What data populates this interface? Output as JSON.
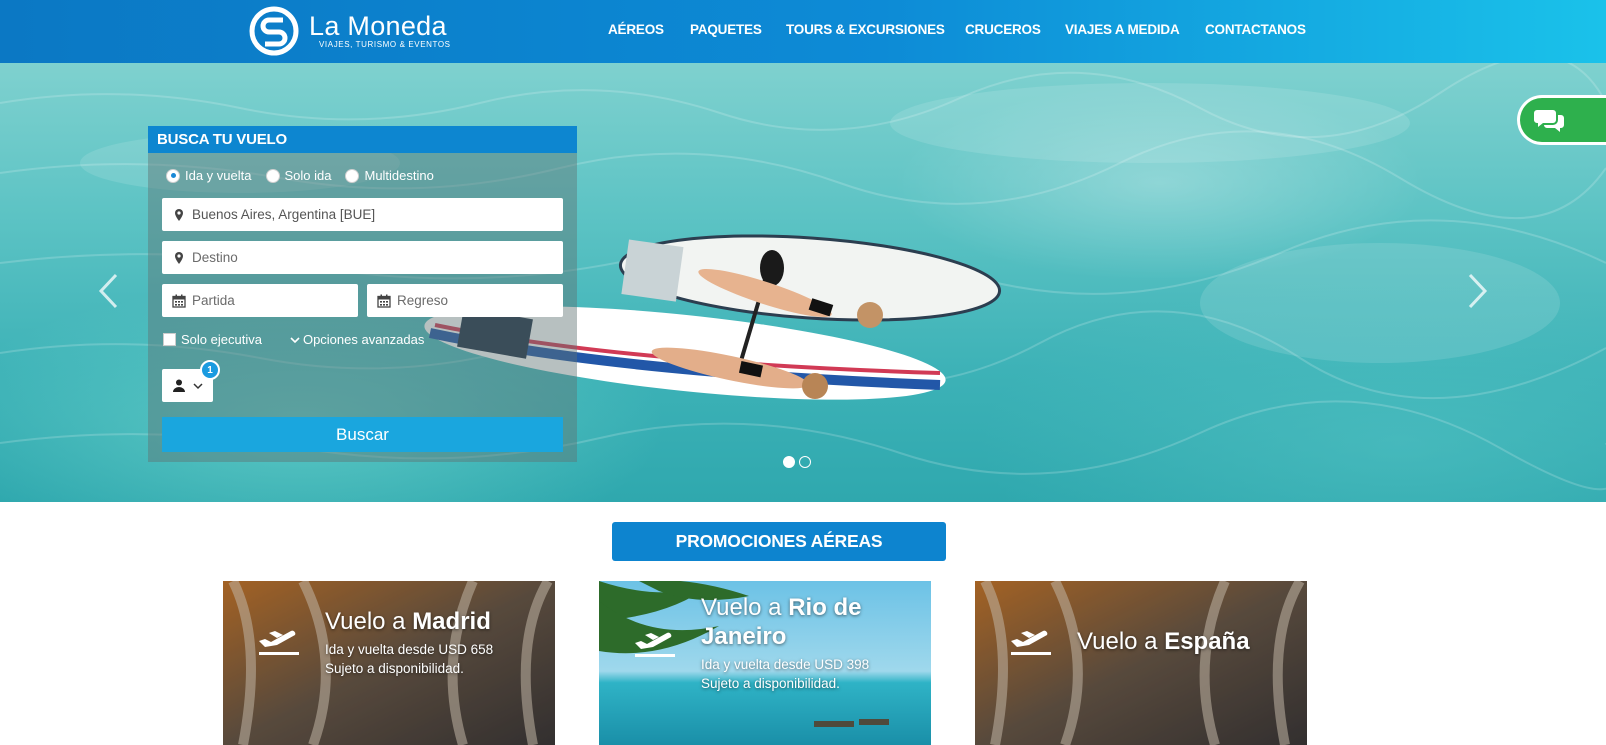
{
  "brand": {
    "name": "La Moneda",
    "tagline": "VIAJES, TURISMO & EVENTOS"
  },
  "nav": {
    "items": [
      "AÉREOS",
      "PAQUETES",
      "TOURS & EXCURSIONES",
      "CRUCEROS",
      "VIAJES A MEDIDA",
      "CONTACTANOS"
    ]
  },
  "search": {
    "title": "BUSCA TU VUELO",
    "trip_types": [
      "Ida y vuelta",
      "Solo ida",
      "Multidestino"
    ],
    "selected_trip_type": "Ida y vuelta",
    "origin_value": "Buenos Aires, Argentina [BUE]",
    "destination_placeholder": "Destino",
    "departure_placeholder": "Partida",
    "return_placeholder": "Regreso",
    "executive_label": "Solo ejecutiva",
    "advanced_label": "Opciones avanzadas",
    "passengers_count": "1",
    "submit_label": "Buscar"
  },
  "carousel": {
    "slide_count": 2,
    "active_slide": 1
  },
  "promos": {
    "title": "PROMOCIONES AÉREAS",
    "cards": [
      {
        "prefix": "Vuelo a ",
        "city": "Madrid",
        "line1": "Ida y vuelta desde USD 658",
        "line2": "Sujeto a disponibilidad."
      },
      {
        "prefix": "Vuelo a ",
        "city": "Rio de Janeiro",
        "line1": "Ida y vuelta desde USD 398",
        "line2": "Sujeto a disponibilidad."
      },
      {
        "prefix": "Vuelo a ",
        "city": "España",
        "line1": "",
        "line2": ""
      }
    ]
  },
  "colors": {
    "header_start": "#0b78c4",
    "header_end": "#1ac2ea",
    "accent": "#0d84cf",
    "button": "#1aa6de",
    "chat": "#2eb04d"
  },
  "icons": [
    "logo-mark-icon",
    "map-marker-icon",
    "calendar-icon",
    "chevron-down-icon",
    "user-icon",
    "chat-icon",
    "airplane-takeoff-icon",
    "chevron-left-icon",
    "chevron-right-icon"
  ]
}
